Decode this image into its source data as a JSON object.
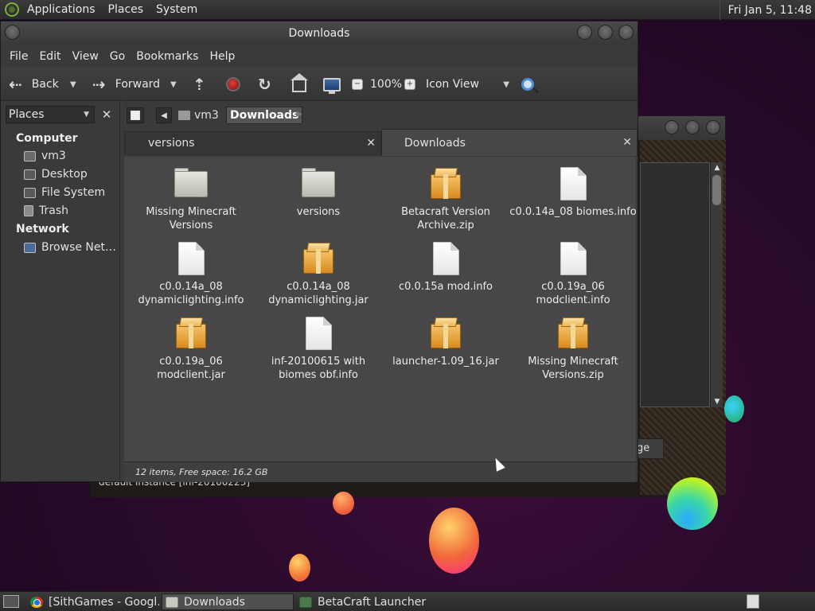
{
  "top_panel": {
    "menus": [
      "Applications",
      "Places",
      "System"
    ],
    "clock": "Fri Jan  5, 11:48"
  },
  "window": {
    "title": "Downloads",
    "menubar": [
      "File",
      "Edit",
      "View",
      "Go",
      "Bookmarks",
      "Help"
    ],
    "toolbar": {
      "back_label": "Back",
      "forward_label": "Forward",
      "zoom_level": "100%",
      "view_mode": "Icon View"
    },
    "sidebar": {
      "selector_label": "Places",
      "sections": [
        {
          "title": "Computer",
          "items": [
            "vm3",
            "Desktop",
            "File System",
            "Trash"
          ]
        },
        {
          "title": "Network",
          "items": [
            "Browse Net…"
          ]
        }
      ]
    },
    "location": {
      "crumbs": [
        "vm3",
        "Downloads"
      ],
      "active_crumb": "Downloads"
    },
    "tabs": [
      {
        "label": "versions",
        "active": false
      },
      {
        "label": "Downloads",
        "active": true
      }
    ],
    "files": [
      {
        "name": "Missing Minecraft Versions",
        "type": "folder"
      },
      {
        "name": "versions",
        "type": "folder"
      },
      {
        "name": "Betacraft Version Archive.zip",
        "type": "package"
      },
      {
        "name": "c0.0.14a_08 biomes.info",
        "type": "document"
      },
      {
        "name": "c0.0.14a_08 dynamiclighting.info",
        "type": "document"
      },
      {
        "name": "c0.0.14a_08 dynamiclighting.jar",
        "type": "package"
      },
      {
        "name": "c0.0.15a mod.info",
        "type": "document"
      },
      {
        "name": "c0.0.19a_06 modclient.info",
        "type": "document"
      },
      {
        "name": "c0.0.19a_06 modclient.jar",
        "type": "package"
      },
      {
        "name": "inf-20100615 with biomes obf.info",
        "type": "document"
      },
      {
        "name": "launcher-1.09_16.jar",
        "type": "package"
      },
      {
        "name": "Missing Minecraft Versions.zip",
        "type": "package"
      }
    ],
    "status": "12 items, Free space: 16.2 GB"
  },
  "background_window": {
    "button_label": "ge",
    "status_text": "default instance [inf-20100223]"
  },
  "taskbar": {
    "tasks": [
      {
        "label": "[SithGames - Googl…",
        "icon": "chrome-icon",
        "active": false
      },
      {
        "label": "Downloads",
        "icon": "folder-icon",
        "active": true
      },
      {
        "label": "BetaCraft Launcher …",
        "icon": "java-icon",
        "active": false
      }
    ]
  }
}
